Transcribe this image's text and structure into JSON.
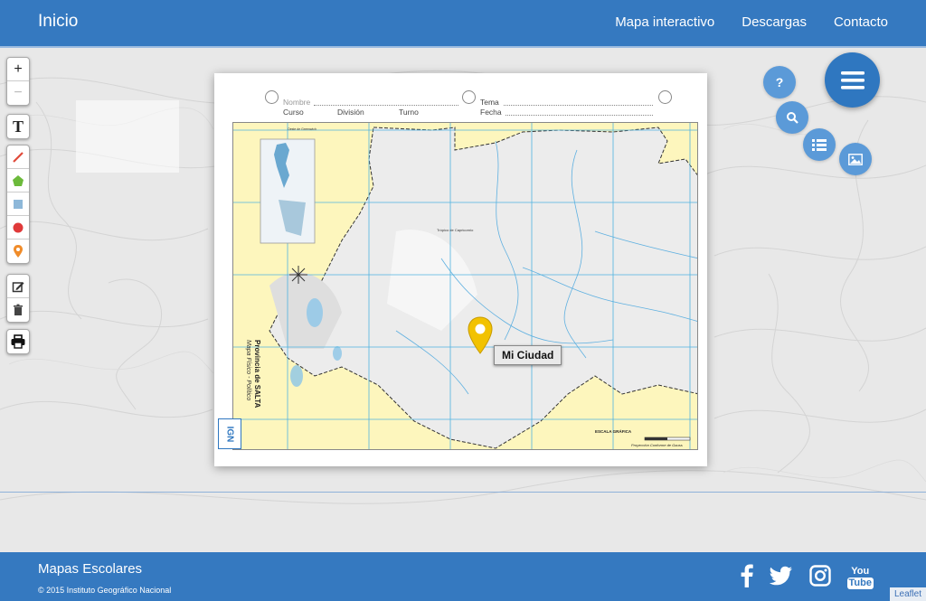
{
  "header": {
    "brand": "Inicio",
    "nav": [
      "Mapa interactivo",
      "Descargas",
      "Contacto"
    ]
  },
  "toolbar": {
    "zoom_in": "+",
    "zoom_out": "−",
    "text_tool": "T"
  },
  "sheet": {
    "nombre": "Nombre",
    "curso": "Curso",
    "division": "División",
    "turno": "Turno",
    "tema": "Tema",
    "fecha": "Fecha",
    "province_title": "Provincia de SALTA",
    "map_subtitle": "Mapa Físico - Político",
    "logo": "IGN",
    "scale_label": "ESCALA GRÁFICA",
    "projection": "Proyección Conforme de Gauss",
    "tropic": "Trópico de Capricornio",
    "greenwich": "Oeste de Greenwich"
  },
  "marker": {
    "label": "Mi Ciudad",
    "color": "#f2c200"
  },
  "fab": {
    "help_label": "?",
    "icons": [
      "menu-icon",
      "help-icon",
      "search-icon",
      "list-icon",
      "image-icon"
    ]
  },
  "footer": {
    "title": "Mapas Escolares",
    "copyright": "© 2015 Instituto Geográfico Nacional",
    "attribution": "Leaflet",
    "social": [
      "facebook-icon",
      "twitter-icon",
      "instagram-icon",
      "youtube-icon"
    ],
    "youtube_top": "You",
    "youtube_bottom": "Tube"
  },
  "colors": {
    "primary": "#3579c0",
    "fab": "#5b9ad8",
    "map_land": "#fdf6bd",
    "map_province": "#ececec",
    "grid": "#4fb3e0"
  }
}
